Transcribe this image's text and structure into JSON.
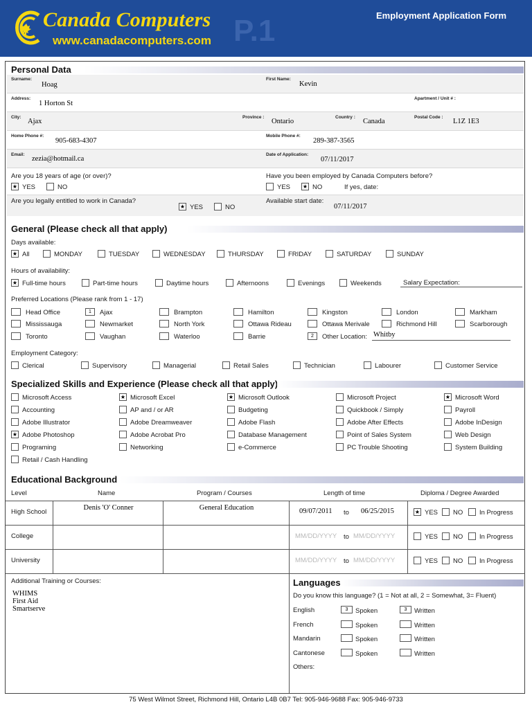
{
  "header": {
    "brand": "Canada Computers",
    "url": "www.canadacomputers.com",
    "page": "P.1",
    "form_title": "Employment Application Form"
  },
  "personal": {
    "title": "Personal Data",
    "surname_label": "Surname:",
    "surname": "Hoag",
    "first_name_label": "First Name:",
    "first_name": "Kevin",
    "address_label": "Address:",
    "address": "1 Horton St",
    "apartment_label": "Apartment / Unit # :",
    "city_label": "City:",
    "city": "Ajax",
    "province_label": "Province :",
    "province": "Ontario",
    "country_label": "Country :",
    "country": "Canada",
    "postal_label": "Postal Code :",
    "postal": "L1Z 1E3",
    "home_phone_label": "Home Phone #:",
    "home_phone": "905-683-4307",
    "mobile_phone_label": "Mobile Phone #:",
    "mobile_phone": "289-387-3565",
    "email_label": "Email:",
    "email": "zezia@hotmail.ca",
    "date_app_label": "Date of Application:",
    "date_app": "07/11/2017",
    "age_q": "Are you 18 years of age (or over)?",
    "employed_q": "Have you been employed by Canada Computers before?",
    "yes": "YES",
    "no": "NO",
    "if_yes": "If yes, date:",
    "legal_q": "Are you legally entitled to work in Canada?",
    "start_label": "Available start date:",
    "start_date": "07/11/2017",
    "age_answer": "YES",
    "employed_answer": "NO",
    "legal_answer": "YES"
  },
  "general": {
    "title": "General (Please check all that apply)",
    "days_label": "Days available:",
    "days": [
      {
        "label": "All",
        "checked": true
      },
      {
        "label": "MONDAY",
        "checked": false
      },
      {
        "label": "TUESDAY",
        "checked": false
      },
      {
        "label": "WEDNESDAY",
        "checked": false
      },
      {
        "label": "THURSDAY",
        "checked": false
      },
      {
        "label": "FRIDAY",
        "checked": false
      },
      {
        "label": "SATURDAY",
        "checked": false
      },
      {
        "label": "SUNDAY",
        "checked": false
      }
    ],
    "hours_label": "Hours of availability:",
    "hours": [
      {
        "label": "Full-time hours",
        "checked": true
      },
      {
        "label": "Part-time hours",
        "checked": false
      },
      {
        "label": "Daytime hours",
        "checked": false
      },
      {
        "label": "Afternoons",
        "checked": false
      },
      {
        "label": "Evenings",
        "checked": false
      },
      {
        "label": "Weekends",
        "checked": false
      }
    ],
    "salary_label": "Salary Expectation:",
    "locations_label": "Preferred Locations (Please rank from 1 - 17)",
    "locations": [
      {
        "label": "Head Office",
        "rank": ""
      },
      {
        "label": "Ajax",
        "rank": "1"
      },
      {
        "label": "Brampton",
        "rank": ""
      },
      {
        "label": "Hamilton",
        "rank": ""
      },
      {
        "label": "Kingston",
        "rank": ""
      },
      {
        "label": "London",
        "rank": ""
      },
      {
        "label": "Markham",
        "rank": ""
      },
      {
        "label": "Mississauga",
        "rank": ""
      },
      {
        "label": "Newmarket",
        "rank": ""
      },
      {
        "label": "North York",
        "rank": ""
      },
      {
        "label": "Ottawa Rideau",
        "rank": ""
      },
      {
        "label": "Ottawa Merivale",
        "rank": ""
      },
      {
        "label": "Richmond Hill",
        "rank": ""
      },
      {
        "label": "Scarborough",
        "rank": ""
      },
      {
        "label": "Toronto",
        "rank": ""
      },
      {
        "label": "Vaughan",
        "rank": ""
      },
      {
        "label": "Waterloo",
        "rank": ""
      },
      {
        "label": "Barrie",
        "rank": ""
      },
      {
        "label": "Other Location:",
        "rank": "2"
      }
    ],
    "other_location": "Whitby",
    "category_label": "Employment Category:",
    "categories": [
      {
        "label": "Clerical",
        "checked": false
      },
      {
        "label": "Supervisory",
        "checked": false
      },
      {
        "label": "Managerial",
        "checked": false
      },
      {
        "label": "Retail Sales",
        "checked": false
      },
      {
        "label": "Technician",
        "checked": false
      },
      {
        "label": "Labourer",
        "checked": false
      },
      {
        "label": "Customer Service",
        "checked": false
      }
    ]
  },
  "skills": {
    "title": "Specialized Skills and Experience (Please check all that apply)",
    "items": [
      {
        "label": "Microsoft Access",
        "checked": false
      },
      {
        "label": "Microsoft Excel",
        "checked": true
      },
      {
        "label": "Microsoft Outlook",
        "checked": true
      },
      {
        "label": "Microsoft Project",
        "checked": false
      },
      {
        "label": "Microsoft Word",
        "checked": true
      },
      {
        "label": "Accounting",
        "checked": false
      },
      {
        "label": "AP and / or AR",
        "checked": false
      },
      {
        "label": "Budgeting",
        "checked": false
      },
      {
        "label": "Quickbook / Simply",
        "checked": false
      },
      {
        "label": "Payroll",
        "checked": false
      },
      {
        "label": "Adobe Illustrator",
        "checked": false
      },
      {
        "label": "Adobe Dreamweaver",
        "checked": false
      },
      {
        "label": "Adobe Flash",
        "checked": false
      },
      {
        "label": "Adobe After Effects",
        "checked": false
      },
      {
        "label": "Adobe InDesign",
        "checked": false
      },
      {
        "label": "Adobe Photoshop",
        "checked": true
      },
      {
        "label": "Adobe Acrobat Pro",
        "checked": false
      },
      {
        "label": "Database Management",
        "checked": false
      },
      {
        "label": "Point of Sales System",
        "checked": false
      },
      {
        "label": "Web Design",
        "checked": false
      },
      {
        "label": "Programing",
        "checked": false
      },
      {
        "label": "Networking",
        "checked": false
      },
      {
        "label": "e-Commerce",
        "checked": false
      },
      {
        "label": "PC Trouble Shooting",
        "checked": false
      },
      {
        "label": "System Building",
        "checked": false
      },
      {
        "label": "Retail / Cash Handling",
        "checked": false
      }
    ]
  },
  "education": {
    "title": "Educational Background",
    "headers": [
      "Level",
      "Name",
      "Program / Courses",
      "Length of time",
      "Diploma / Degree Awarded"
    ],
    "date_placeholder": "MM/DD/YYYY",
    "to": "to",
    "opt_yes": "YES",
    "opt_no": "NO",
    "opt_progress": "In Progress",
    "rows": [
      {
        "level": "High School",
        "name": "Denis 'O' Conner",
        "program": "General Education",
        "from": "09/07/2011",
        "until": "06/25/2015",
        "diploma": "YES"
      },
      {
        "level": "College",
        "name": "",
        "program": "",
        "from": "",
        "until": "",
        "diploma": ""
      },
      {
        "level": "University",
        "name": "",
        "program": "",
        "from": "",
        "until": "",
        "diploma": ""
      }
    ],
    "additional_label": "Additional Training or Courses:",
    "additional": [
      "WHIMS",
      "First Aid",
      "Smartserve"
    ]
  },
  "languages": {
    "title": "Languages",
    "question": "Do you know this language? (1 = Not at all, 2 = Somewhat, 3= Fluent)",
    "spoken": "Spoken",
    "written": "Written",
    "items": [
      {
        "name": "English",
        "spoken": "3",
        "written": "3"
      },
      {
        "name": "French",
        "spoken": "",
        "written": ""
      },
      {
        "name": "Mandarin",
        "spoken": "",
        "written": ""
      },
      {
        "name": "Cantonese",
        "spoken": "",
        "written": ""
      }
    ],
    "others_label": "Others:"
  },
  "footer": "75 West Wilmot Street, Richmond Hill, Ontario L4B 0B7  Tel: 905-946-9688  Fax: 905-946-9733",
  "colors": {
    "header_bg": "#1f4c99",
    "brand_yellow": "#f5d711"
  }
}
